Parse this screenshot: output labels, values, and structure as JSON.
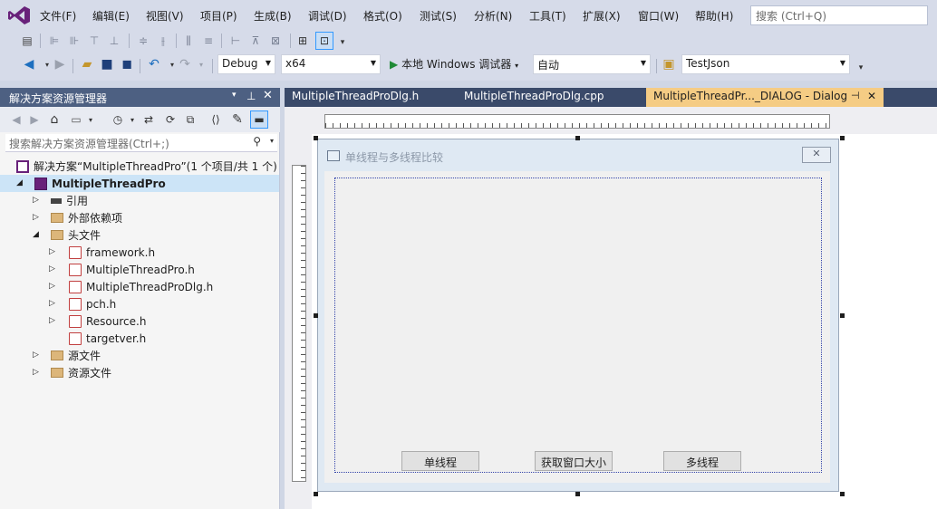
{
  "menu": {
    "items": [
      "文件(F)",
      "编辑(E)",
      "视图(V)",
      "项目(P)",
      "生成(B)",
      "调试(D)",
      "格式(O)",
      "测试(S)",
      "分析(N)",
      "工具(T)",
      "扩展(X)",
      "窗口(W)",
      "帮助(H)"
    ],
    "search_placeholder": "搜索 (Ctrl+Q)"
  },
  "toolbar": {
    "config": "Debug",
    "platform": "x64",
    "run_label": "本地 Windows 调试器",
    "run_mode": "自动",
    "project_combo": "TestJson"
  },
  "solution_explorer": {
    "title": "解决方案资源管理器",
    "search_placeholder": "搜索解决方案资源管理器(Ctrl+;)",
    "solution_label": "解决方案“MultipleThreadPro”(1 个项目/共 1 个)",
    "project_label": "MultipleThreadPro",
    "nodes": {
      "references": "引用",
      "external_deps": "外部依赖项",
      "headers": "头文件",
      "header_files": [
        "framework.h",
        "MultipleThreadPro.h",
        "MultipleThreadProDlg.h",
        "pch.h",
        "Resource.h",
        "targetver.h"
      ],
      "sources": "源文件",
      "resources": "资源文件"
    }
  },
  "tabs": [
    {
      "label": "MultipleThreadProDlg.h",
      "active": false
    },
    {
      "label": "MultipleThreadProDlg.cpp",
      "active": false
    },
    {
      "label": "MultipleThreadPr..._DIALOG - Dialog",
      "active": true
    }
  ],
  "dialog": {
    "title": "单线程与多线程比较",
    "buttons": [
      "单线程",
      "获取窗口大小",
      "多线程"
    ]
  },
  "colors": {
    "title_bar": "#4d6082",
    "active_tab": "#f5cc84",
    "tab_strip": "#3a4a6a"
  }
}
